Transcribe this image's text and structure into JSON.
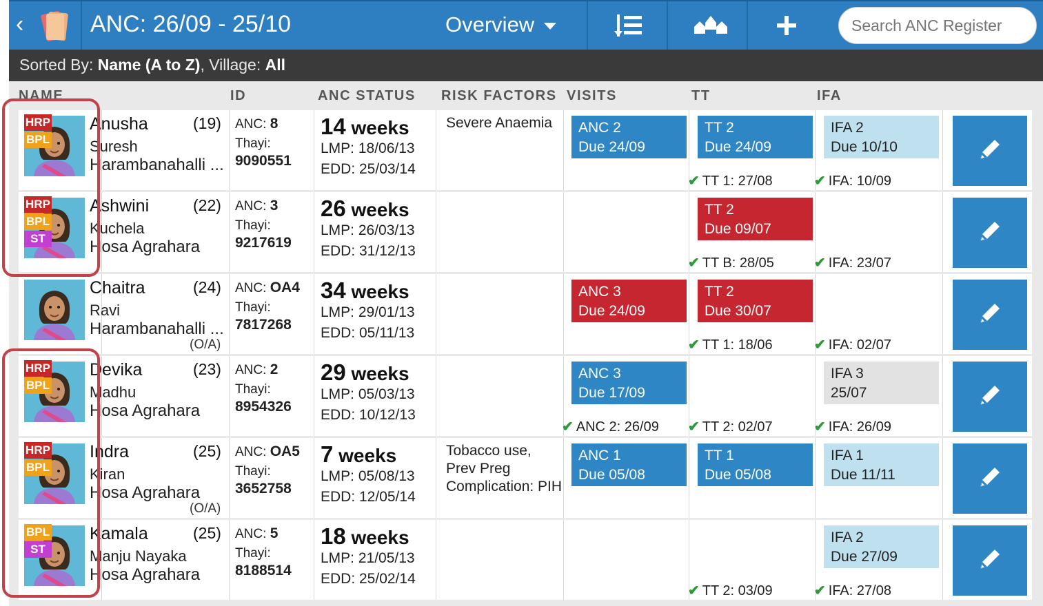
{
  "app": {
    "title": "ANC: 26/09 - 25/10",
    "view": "Overview",
    "search_placeholder": "Search ANC Register"
  },
  "sort": {
    "prefix": "Sorted By:",
    "field": "Name (A to Z)",
    "sep": ", Village:",
    "village": "All"
  },
  "columns": [
    "NAME",
    "ID",
    "ANC STATUS",
    "RISK FACTORS",
    "VISITS",
    "TT",
    "IFA"
  ],
  "colors": {
    "header": "#2d7fc1",
    "blue": "#2e86c5",
    "red": "#c6262f",
    "light_blue": "#bfe0ef",
    "grey": "#e2e2e2",
    "badge_hrp": "#c62828",
    "badge_bpl": "#f0a21a",
    "badge_st": "#c140d2",
    "highlight": "#c0434a",
    "check": "#2e9a3a"
  },
  "icons": [
    "chevron-left-icon",
    "register-book-icon",
    "caret-down-icon",
    "list-sort-icon",
    "village-houses-icon",
    "plus-icon",
    "pencil-icon",
    "check-icon",
    "woman-avatar-icon"
  ],
  "rows": [
    {
      "name": "Anusha",
      "age": "(19)",
      "husband": "Suresh",
      "village": "Harambanahalli ...",
      "oa": "",
      "anc_label": "ANC:",
      "anc": "8",
      "thayi_label": "Thayi:",
      "thayi": "9090551",
      "weeks": "14",
      "weeks_unit": " weeks",
      "lmp": "LMP: 18/06/13",
      "edd": "EDD: 25/03/14",
      "risk": "Severe Anaemia",
      "badges": [
        "HRP",
        "BPL"
      ],
      "visit_box": {
        "l1": "ANC 2",
        "l2": "Due 24/09",
        "color": "blue"
      },
      "visit_done": "",
      "tt_box": {
        "l1": "TT 2",
        "l2": "Due 24/09",
        "color": "blue"
      },
      "tt_done": "TT 1: 27/08",
      "ifa_box": {
        "l1": "IFA 2",
        "l2": "Due 10/10",
        "color": "lblue"
      },
      "ifa_done": "IFA: 10/09"
    },
    {
      "name": "Ashwini",
      "age": "(22)",
      "husband": "Kuchela",
      "village": "Hosa Agrahara",
      "oa": "",
      "anc_label": "ANC:",
      "anc": "3",
      "thayi_label": "Thayi:",
      "thayi": "9217619",
      "weeks": "26",
      "weeks_unit": " weeks",
      "lmp": "LMP: 26/03/13",
      "edd": "EDD: 31/12/13",
      "risk": "",
      "badges": [
        "HRP",
        "BPL",
        "ST"
      ],
      "visit_box": null,
      "visit_done": "",
      "tt_box": {
        "l1": "TT 2",
        "l2": "Due 09/07",
        "color": "red"
      },
      "tt_done": "TT B: 28/05",
      "ifa_box": null,
      "ifa_done": "IFA: 23/07"
    },
    {
      "name": "Chaitra",
      "age": "(24)",
      "husband": "Ravi",
      "village": "Harambanahalli ...",
      "oa": "(O/A)",
      "anc_label": "ANC:",
      "anc": "OA4",
      "thayi_label": "Thayi:",
      "thayi": "7817268",
      "weeks": "34",
      "weeks_unit": " weeks",
      "lmp": "LMP: 29/01/13",
      "edd": "EDD: 05/11/13",
      "risk": "",
      "badges": [],
      "visit_box": {
        "l1": "ANC 3",
        "l2": "Due 24/09",
        "color": "red"
      },
      "visit_done": "",
      "tt_box": {
        "l1": "TT 2",
        "l2": "Due 30/07",
        "color": "red"
      },
      "tt_done": "TT 1: 18/06",
      "ifa_box": null,
      "ifa_done": "IFA: 02/07"
    },
    {
      "name": "Devika",
      "age": "(23)",
      "husband": "Madhu",
      "village": "Hosa Agrahara",
      "oa": "",
      "anc_label": "ANC:",
      "anc": "2",
      "thayi_label": "Thayi:",
      "thayi": "8954326",
      "weeks": "29",
      "weeks_unit": " weeks",
      "lmp": "LMP: 05/03/13",
      "edd": "EDD: 10/12/13",
      "risk": "",
      "badges": [
        "HRP",
        "BPL"
      ],
      "visit_box": {
        "l1": "ANC 3",
        "l2": "Due 17/09",
        "color": "blue"
      },
      "visit_done": "ANC 2: 26/09",
      "tt_box": null,
      "tt_done": "TT 2: 02/07",
      "ifa_box": {
        "l1": "IFA 3",
        "l2": "25/07",
        "color": "grey"
      },
      "ifa_done": "IFA: 26/09"
    },
    {
      "name": "Indra",
      "age": "(25)",
      "husband": "Kiran",
      "village": "Hosa Agrahara",
      "oa": "(O/A)",
      "anc_label": "ANC:",
      "anc": "OA5",
      "thayi_label": "Thayi:",
      "thayi": "3652758",
      "weeks": "7",
      "weeks_unit": " weeks",
      "lmp": "LMP: 05/08/13",
      "edd": "EDD: 12/05/14",
      "risk": "Tobacco use, Prev Preg Complication: PIH",
      "badges": [
        "HRP",
        "BPL"
      ],
      "visit_box": {
        "l1": "ANC 1",
        "l2": "Due 05/08",
        "color": "blue"
      },
      "visit_done": "",
      "tt_box": {
        "l1": "TT 1",
        "l2": "Due 05/08",
        "color": "blue"
      },
      "tt_done": "",
      "ifa_box": {
        "l1": "IFA 1",
        "l2": "Due 11/11",
        "color": "lblue"
      },
      "ifa_done": ""
    },
    {
      "name": "Kamala",
      "age": "(25)",
      "husband": "Manju Nayaka",
      "village": "Hosa Agrahara",
      "oa": "",
      "anc_label": "ANC:",
      "anc": "5",
      "thayi_label": "Thayi:",
      "thayi": "8188514",
      "weeks": "18",
      "weeks_unit": " weeks",
      "lmp": "LMP: 21/05/13",
      "edd": "EDD: 25/02/14",
      "risk": "",
      "badges": [
        "BPL",
        "ST"
      ],
      "visit_box": null,
      "visit_done": "",
      "tt_box": null,
      "tt_done": "TT 2: 03/09",
      "ifa_box": {
        "l1": "IFA 2",
        "l2": "Due 27/09",
        "color": "lblue"
      },
      "ifa_done": "IFA: 27/08"
    }
  ]
}
